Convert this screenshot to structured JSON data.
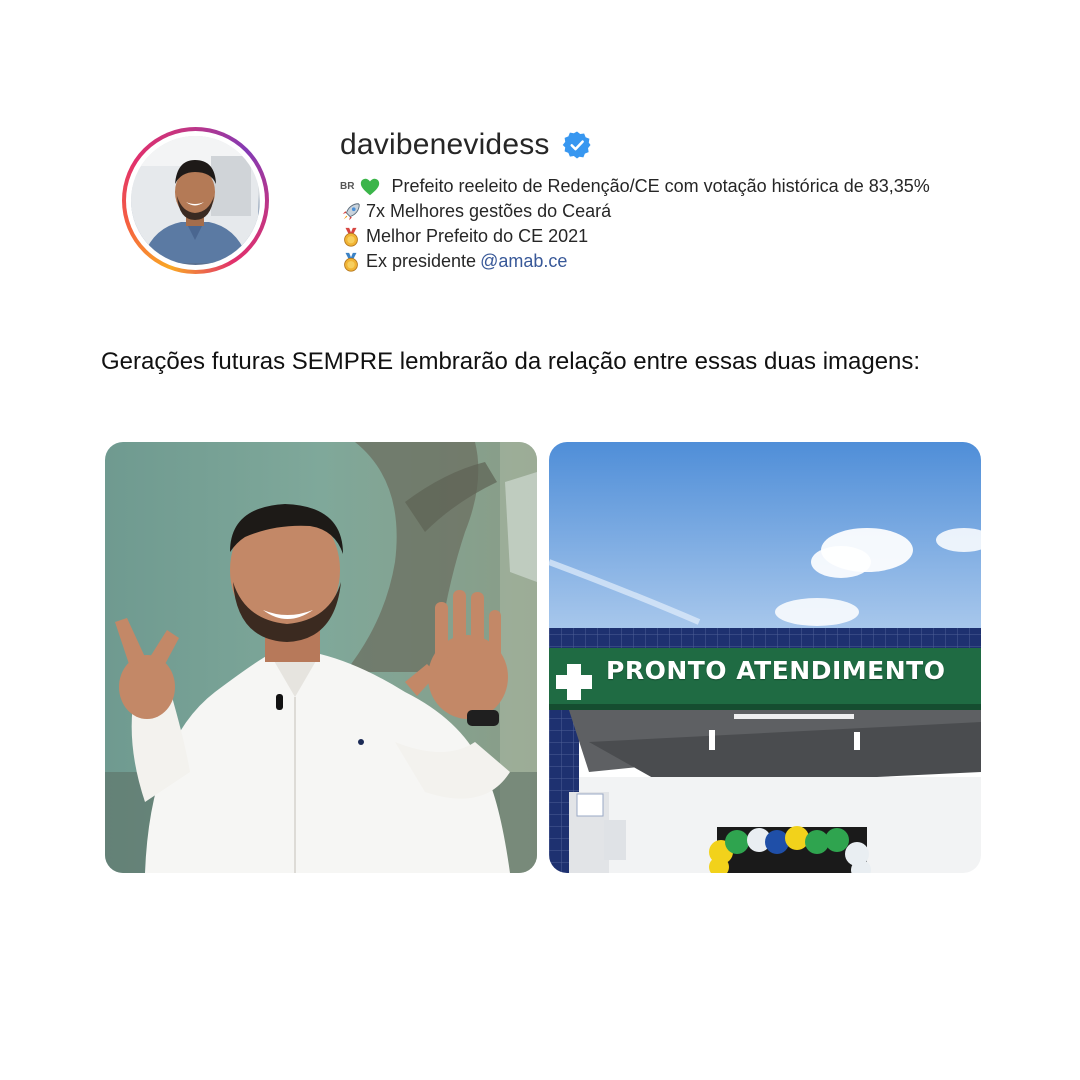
{
  "profile": {
    "username": "davibenevidess",
    "avatar_icon": "profile-photo",
    "verified_icon": "verified-badge-icon",
    "bio": [
      {
        "prefix": "BR",
        "icon": "green-heart-icon",
        "text": "Prefeito reeleito de Redenção/CE com votação histórica de 83,35%"
      },
      {
        "icon": "rocket-icon",
        "text": "7x Melhores gestões do Ceará"
      },
      {
        "icon": "gold-medal-icon",
        "text": "Melhor Prefeito do CE 2021"
      },
      {
        "icon": "medal-icon",
        "text": "Ex presidente ",
        "mention": "@amab.ce"
      }
    ]
  },
  "caption": "Gerações futuras SEMPRE lembrarão da relação entre essas duas imagens:",
  "photos": {
    "left": {
      "icon": "man-in-white-shirt-photo"
    },
    "right": {
      "icon": "health-unit-building-photo",
      "sign_text": "PRONTO  ATENDIMENTO"
    }
  },
  "colors": {
    "verified": "#3897f0",
    "mention": "#385898",
    "sign_green": "#1f6b43"
  }
}
